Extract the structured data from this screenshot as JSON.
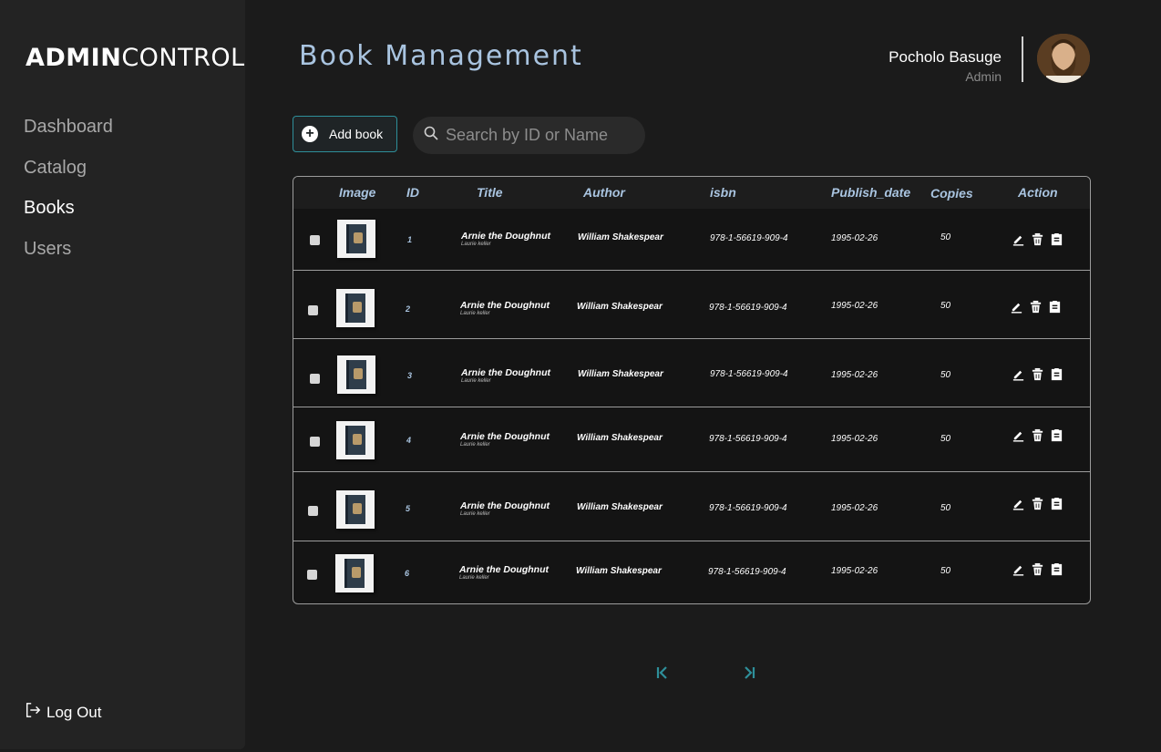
{
  "brand": {
    "bold": "ADMIN",
    "light": "CONTROL"
  },
  "nav": {
    "items": [
      {
        "label": "Dashboard"
      },
      {
        "label": "Catalog"
      },
      {
        "label": "Books"
      },
      {
        "label": "Users"
      }
    ],
    "active": "Books",
    "logout_label": "Log Out"
  },
  "header": {
    "title": "Book Management"
  },
  "user": {
    "name": "Pocholo Basuge",
    "role": "Admin"
  },
  "toolbar": {
    "add_label": "Add book",
    "search_placeholder": "Search by ID or Name"
  },
  "table": {
    "columns": [
      "Image",
      "ID",
      "Title",
      "Author",
      "isbn",
      "Publish_date",
      "Copies",
      "Action"
    ],
    "rows": [
      {
        "id": "1",
        "title": "Arnie the Doughnut",
        "subtitle": "Laurie keller",
        "author": "William Shakespear",
        "isbn": "978-1-56619-909-4",
        "date": "1995-02-26",
        "copies": "50"
      },
      {
        "id": "2",
        "title": "Arnie the Doughnut",
        "subtitle": "Laurie keller",
        "author": "William Shakespear",
        "isbn": "978-1-56619-909-4",
        "date": "1995-02-26",
        "copies": "50"
      },
      {
        "id": "3",
        "title": "Arnie the Doughnut",
        "subtitle": "Laurie keller",
        "author": "William Shakespear",
        "isbn": "978-1-56619-909-4",
        "date": "1995-02-26",
        "copies": "50"
      },
      {
        "id": "4",
        "title": "Arnie the Doughnut",
        "subtitle": "Laurie keller",
        "author": "William Shakespear",
        "isbn": "978-1-56619-909-4",
        "date": "1995-02-26",
        "copies": "50"
      },
      {
        "id": "5",
        "title": "Arnie the Doughnut",
        "subtitle": "Laurie keller",
        "author": "William Shakespear",
        "isbn": "978-1-56619-909-4",
        "date": "1995-02-26",
        "copies": "50"
      },
      {
        "id": "6",
        "title": "Arnie the Doughnut",
        "subtitle": "Laurie keller",
        "author": "William Shakespear",
        "isbn": "978-1-56619-909-4",
        "date": "1995-02-26",
        "copies": "50"
      }
    ]
  },
  "icons": {
    "add": "plus-circle-icon",
    "search": "search-icon",
    "logout": "logout-icon",
    "edit": "pencil-icon",
    "delete": "trash-icon",
    "details": "clipboard-icon",
    "first_page": "first-page-icon",
    "last_page": "last-page-icon"
  },
  "colors": {
    "accent": "#2e8f9a",
    "title": "#a9c4e0",
    "background": "#1b1b1b",
    "sidebar": "#232323"
  }
}
